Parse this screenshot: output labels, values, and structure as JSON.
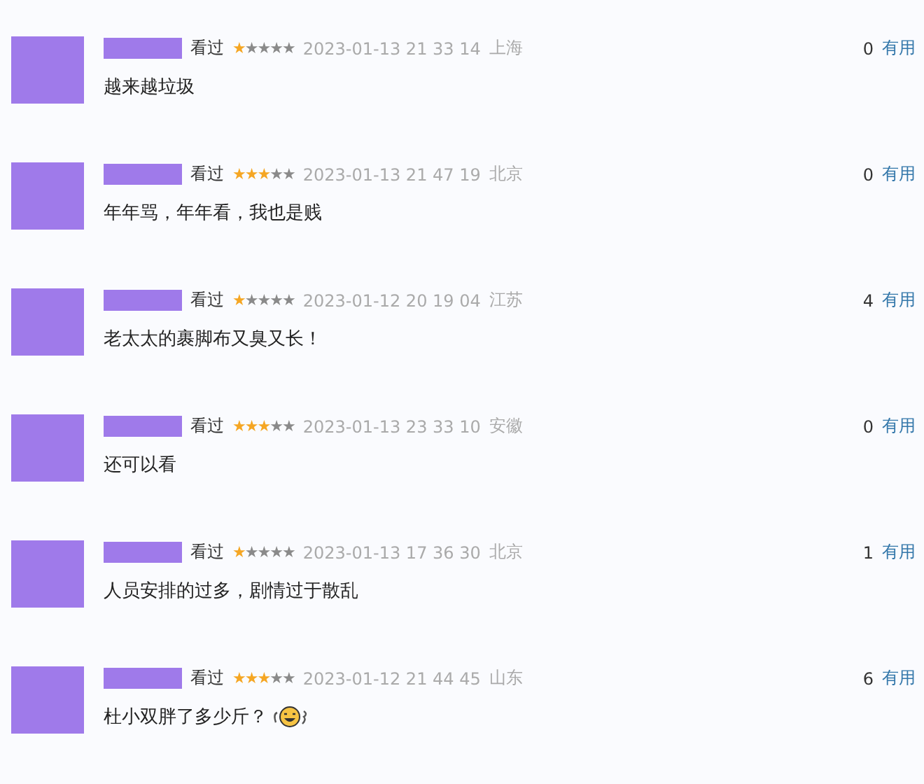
{
  "comments": [
    {
      "status": "看过",
      "stars": 1,
      "time": "2023-01-13 21 33 14",
      "location": "上海",
      "votes": "0",
      "vote_label": "有用",
      "text": "越来越垃圾",
      "emoji": false
    },
    {
      "status": "看过",
      "stars": 3,
      "time": "2023-01-13 21 47 19",
      "location": "北京",
      "votes": "0",
      "vote_label": "有用",
      "text": "年年骂，年年看，我也是贱",
      "emoji": false
    },
    {
      "status": "看过",
      "stars": 1,
      "time": "2023-01-12 20 19 04",
      "location": "江苏",
      "votes": "4",
      "vote_label": "有用",
      "text": "老太太的裹脚布又臭又长！",
      "emoji": false
    },
    {
      "status": "看过",
      "stars": 3,
      "time": "2023-01-13 23 33 10",
      "location": "安徽",
      "votes": "0",
      "vote_label": "有用",
      "text": "还可以看",
      "emoji": false
    },
    {
      "status": "看过",
      "stars": 1,
      "time": "2023-01-13 17 36 30",
      "location": "北京",
      "votes": "1",
      "vote_label": "有用",
      "text": "人员安排的过多，剧情过于散乱",
      "emoji": false
    },
    {
      "status": "看过",
      "stars": 3,
      "time": "2023-01-12 21 44 45",
      "location": "山东",
      "votes": "6",
      "vote_label": "有用",
      "text": "杜小双胖了多少斤？",
      "emoji": true
    }
  ]
}
